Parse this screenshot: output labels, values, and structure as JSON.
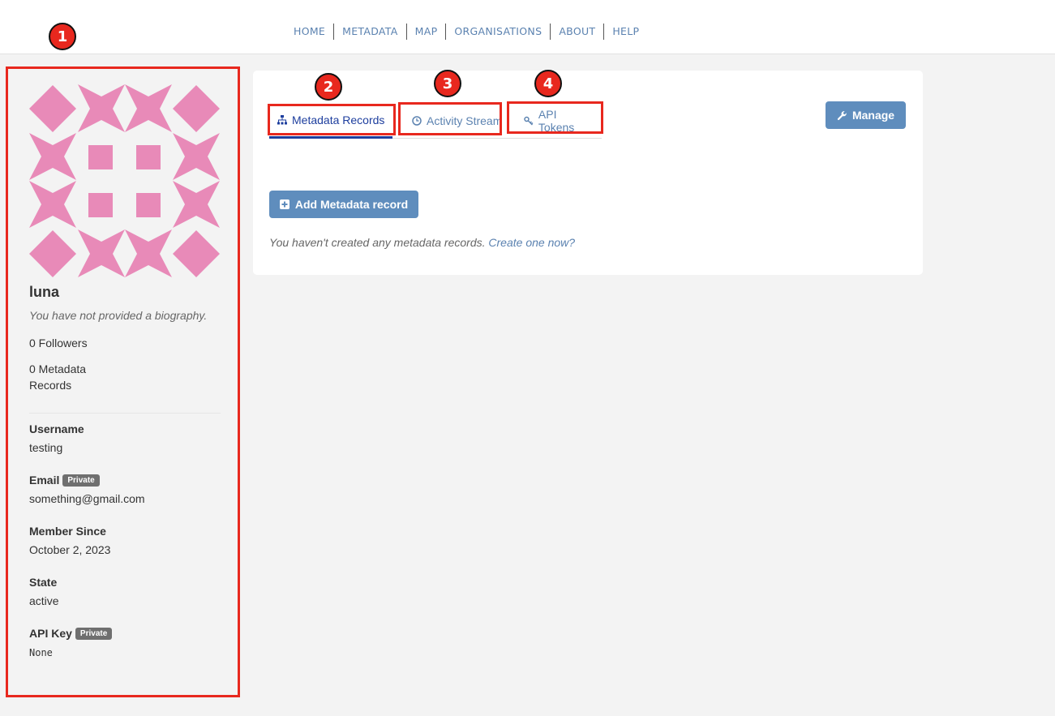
{
  "nav": {
    "items": [
      "HOME",
      "METADATA",
      "MAP",
      "ORGANISATIONS",
      "ABOUT",
      "HELP"
    ]
  },
  "profile": {
    "avatar_color": "#e88ab8",
    "name": "luna",
    "bio": "You have not provided a biography.",
    "followers": "0 Followers",
    "records": "0 Metadata Records",
    "fields": {
      "username_label": "Username",
      "username": "testing",
      "email_label": "Email",
      "email": "something@gmail.com",
      "private_badge": "Private",
      "member_label": "Member Since",
      "member_since": "October 2, 2023",
      "state_label": "State",
      "state": "active",
      "apikey_label": "API Key",
      "apikey": "None"
    }
  },
  "tabs": {
    "records": "Metadata Records",
    "activity": "Activity Stream",
    "tokens": "API Tokens"
  },
  "buttons": {
    "manage": "Manage",
    "add_record": "Add Metadata record"
  },
  "empty": {
    "message": "You haven't created any metadata records.",
    "link": "Create one now?"
  },
  "annotations": {
    "markers": [
      "1",
      "2",
      "3",
      "4"
    ],
    "color": "#e8281e"
  }
}
